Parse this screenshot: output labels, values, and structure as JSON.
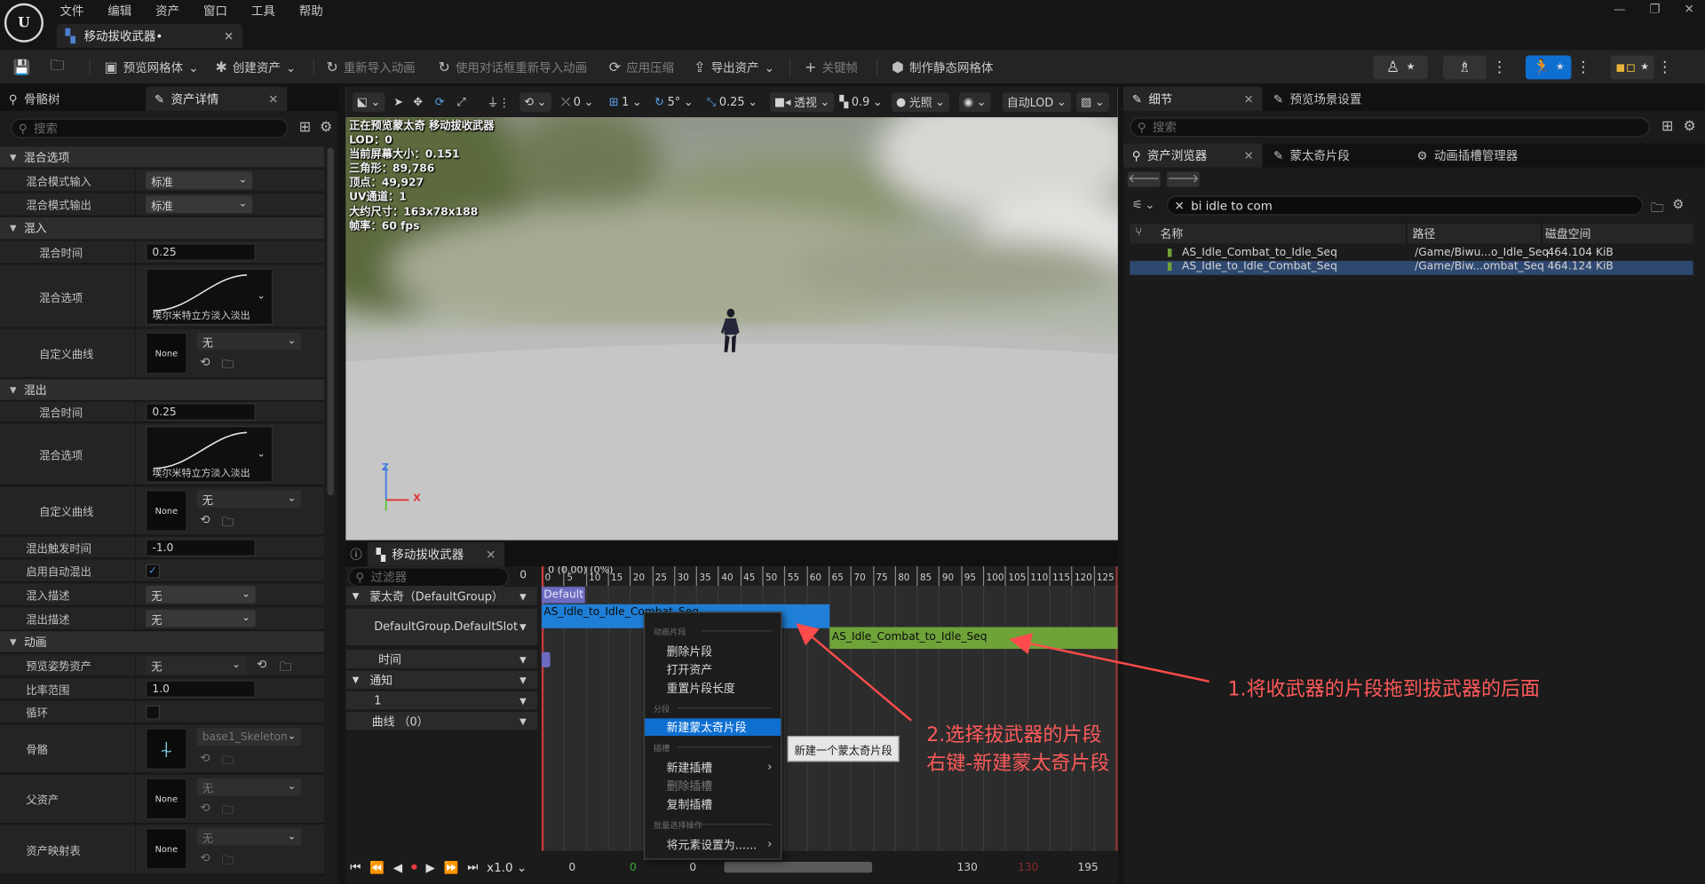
{
  "app": {
    "menus": [
      "文件",
      "编辑",
      "资产",
      "窗口",
      "工具",
      "帮助"
    ],
    "document_tab": "移动拔收武器•"
  },
  "toolbar": {
    "preview_mesh": "预览网格体",
    "create_asset": "创建资产",
    "reimport_anim": "重新导入动画",
    "reimport_dialog": "使用对话框重新导入动画",
    "apply_compression": "应用压缩",
    "export_asset": "导出资产",
    "keyframe": "关键帧",
    "make_static_mesh": "制作静态网格体"
  },
  "left_panel": {
    "tabs": [
      "骨骼树",
      "资产详情"
    ],
    "search_placeholder": "搜索",
    "categories": {
      "blend_options": "混合选项",
      "blend_in": "混入",
      "blend_out": "混出",
      "animation": "动画"
    },
    "rows": {
      "blend_mode_in": "混合模式输入",
      "blend_mode_out": "混合模式输出",
      "blend_time": "混合时间",
      "blend_option": "混合选项",
      "custom_curve": "自定义曲线",
      "blend_out_trigger_time": "混出触发时间",
      "enable_auto_blend_out": "启用自动混出",
      "blend_in_desc": "混入描述",
      "blend_out_desc": "混出描述",
      "preview_pose_asset": "预览姿势资产",
      "rate_scale": "比率范围",
      "loop": "循环",
      "skeleton": "骨骼",
      "parent_asset": "父资产",
      "asset_mapping_table": "资产映射表"
    },
    "values": {
      "standard": "标准",
      "blend_time_in": "0.25",
      "blend_time_out": "0.25",
      "curve_caption": "埃尔米特立方淡入淡出",
      "none_thumb": "None",
      "none_cn": "无",
      "trigger_time": "-1.0",
      "rate_scale": "1.0",
      "skeleton": "base1_Skeleton"
    }
  },
  "viewport": {
    "toolbar": {
      "rot_snap": "0",
      "grid": "1",
      "angle": "5°",
      "scale": "0.25",
      "perspective": "透视",
      "speed": "0.9",
      "lighting": "光照",
      "auto_lod": "自动LOD"
    },
    "info": [
      "正在预览蒙太奇 移动拔收武器",
      "LOD：0",
      "当前屏幕大小：0.151",
      "三角形：89,786",
      "顶点：49,927",
      "UV通道：1",
      "大约尺寸：163x78x188",
      "帧率：60 fps"
    ],
    "axis_z": "Z",
    "axis_x": "X"
  },
  "montage_panel": {
    "tab": "移动拔收武器",
    "filter_placeholder": "过滤器",
    "filter_count": "0",
    "tracks": {
      "montage": "蒙太奇（DefaultGroup）",
      "slot": "DefaultGroup.DefaultSlot",
      "time": "时间",
      "notify": "通知",
      "notify_track": "1",
      "curves": "曲线 （0）"
    },
    "ruler_label": "0 (0.00) (0%)",
    "ticks": [
      "0",
      "5",
      "10",
      "15",
      "20",
      "25",
      "30",
      "35",
      "40",
      "45",
      "50",
      "55",
      "60",
      "65",
      "70",
      "75",
      "80",
      "85",
      "90",
      "95",
      "100",
      "105",
      "110",
      "115",
      "120",
      "125"
    ],
    "section_default": "Default",
    "segment_1": "AS_Idle_to_Idle_Combat_Seq",
    "segment_2": "AS_Idle_Combat_to_Idle_Seq",
    "transport": {
      "speed": "x1.0",
      "v1": "0",
      "v2": "0",
      "v3": "0",
      "v4": "130",
      "v5": "130",
      "v6": "195"
    }
  },
  "context_menu": {
    "sec_segment": "动画片段",
    "delete_segment": "删除片段",
    "open_asset": "打开资产",
    "reset_length": "重置片段长度",
    "sec_section": "分段",
    "new_montage_section": "新建蒙太奇片段",
    "sec_slot": "插槽",
    "new_slot": "新建插槽",
    "delete_slot": "删除插槽",
    "duplicate_slot": "复制插槽",
    "sec_batch": "批量选择操作",
    "set_elements": "将元素设置为......",
    "tooltip": "新建一个蒙太奇片段"
  },
  "right_panel": {
    "tabs": [
      "细节",
      "预览场景设置"
    ],
    "search_placeholder": "搜索",
    "sub_tabs": [
      "资产浏览器",
      "蒙太奇片段",
      "动画插槽管理器"
    ],
    "filter_text": "bi idle to com",
    "columns": [
      "名称",
      "路径",
      "磁盘空间"
    ],
    "rows": [
      {
        "name": "AS_Idle_Combat_to_Idle_Seq",
        "path": "/Game/Biwu...o_Idle_Seq",
        "size": "464.104 KiB"
      },
      {
        "name": "AS_Idle_to_Idle_Combat_Seq",
        "path": "/Game/Biw...ombat_Seq",
        "size": "464.124 KiB"
      }
    ]
  },
  "annotations": {
    "a1": "1.将收武器的片段拖到拔武器的后面",
    "a2_line1": "2.选择拔武器的片段",
    "a2_line2": "右键-新建蒙太奇片段"
  },
  "colors": {
    "accent": "#0e6fd1",
    "segment_blue": "#1f7fd6",
    "segment_green": "#6fa33a",
    "annotation": "#ff5a5a",
    "section_purple": "#6c6bc2"
  }
}
